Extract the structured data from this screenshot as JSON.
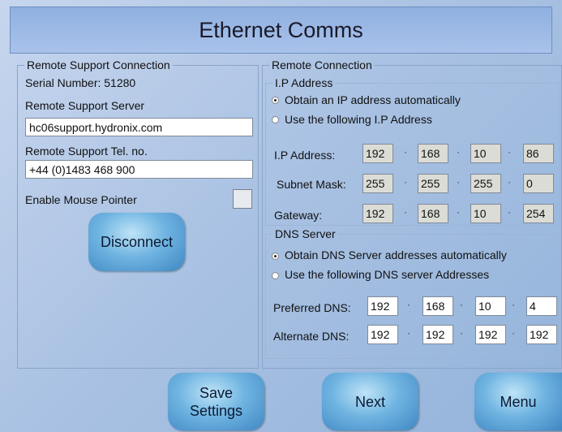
{
  "title": "Ethernet Comms",
  "remote_support": {
    "legend": "Remote Support Connection",
    "serial_label": "Serial Number: 51280",
    "server_label": "Remote Support Server",
    "server_value": "hc06support.hydronix.com",
    "tel_label": "Remote Support Tel. no.",
    "tel_value": "+44 (0)1483 468 900",
    "mouse_label": "Enable Mouse Pointer",
    "disconnect_label": "Disconnect"
  },
  "remote_connection": {
    "legend": "Remote Connection",
    "ip_group": {
      "legend": "I.P Address",
      "radio_auto": "Obtain an IP address automatically",
      "radio_manual": "Use the following I.P Address",
      "ip_label": "I.P Address:",
      "ip": [
        "192",
        "168",
        "10",
        "86"
      ],
      "subnet_label": "Subnet Mask:",
      "subnet": [
        "255",
        "255",
        "255",
        "0"
      ],
      "gateway_label": "Gateway:",
      "gateway": [
        "192",
        "168",
        "10",
        "254"
      ]
    },
    "dns_group": {
      "legend": "DNS Server",
      "radio_auto": "Obtain DNS Server addresses automatically",
      "radio_manual": "Use the following DNS server Addresses",
      "preferred_label": "Preferred DNS:",
      "preferred": [
        "192",
        "168",
        "10",
        "4"
      ],
      "alternate_label": "Alternate DNS:",
      "alternate": [
        "192",
        "192",
        "192",
        "192"
      ]
    }
  },
  "buttons": {
    "save": "Save\nSettings",
    "next": "Next",
    "menu": "Menu"
  },
  "separator": "·"
}
